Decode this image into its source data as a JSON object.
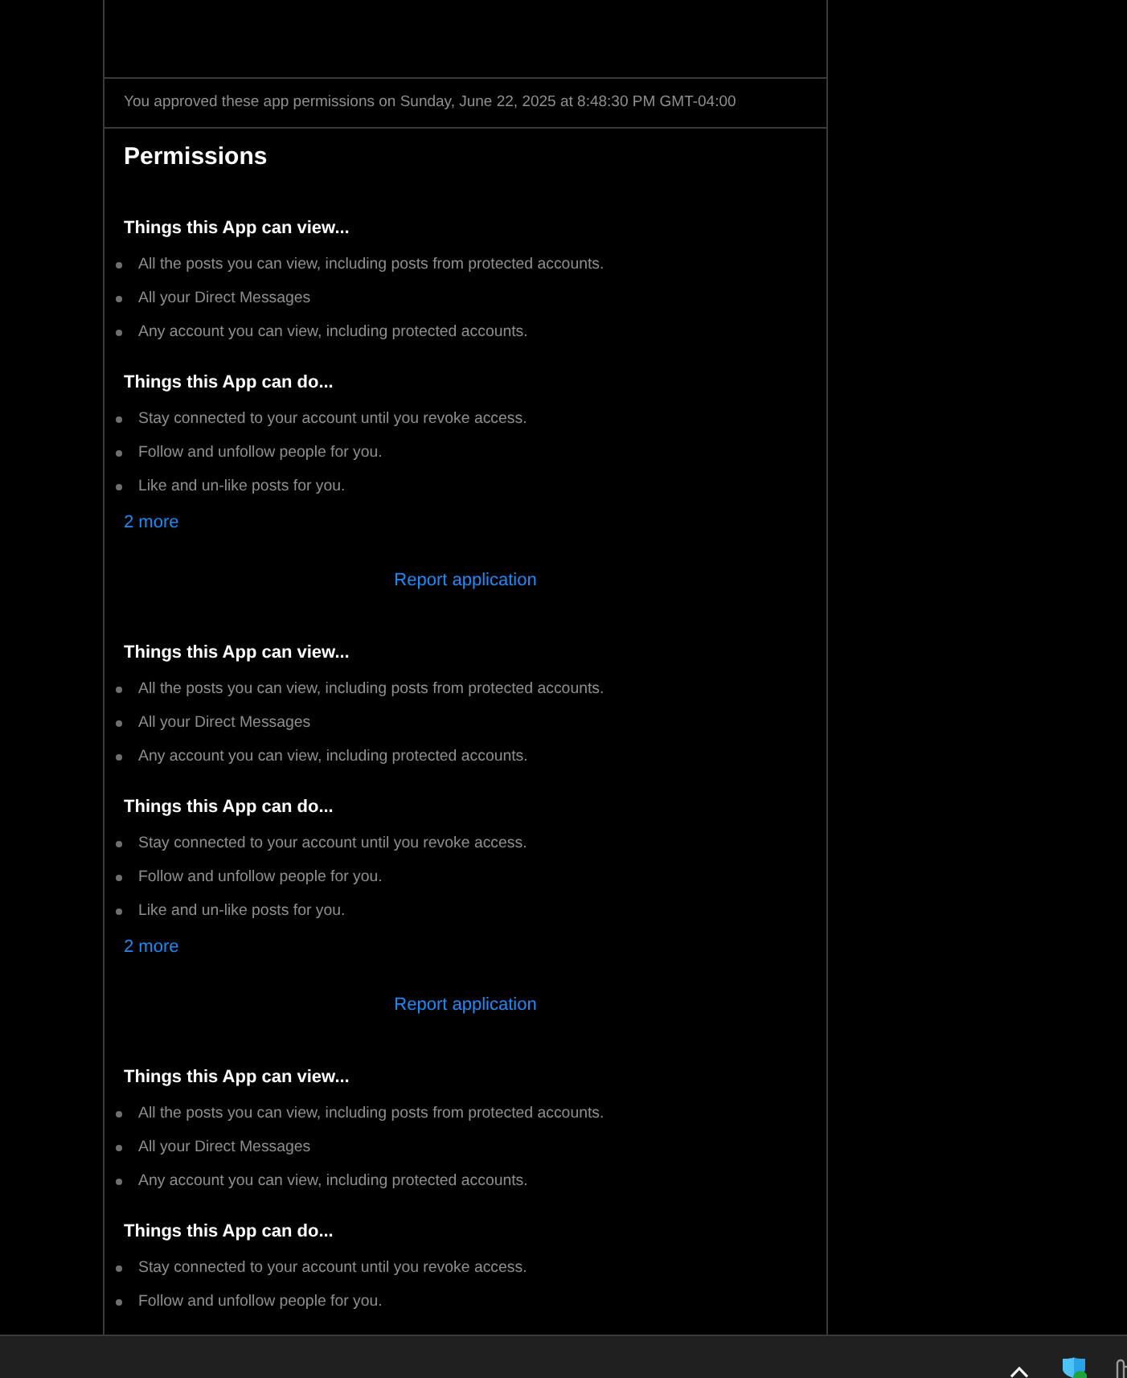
{
  "approval_note": "You approved these app permissions on Sunday, June 22, 2025 at 8:48:30 PM GMT-04:00",
  "permissions": {
    "title": "Permissions",
    "groups": [
      {
        "sections": [
          {
            "heading": "Things this App can view...",
            "items": [
              "All the posts you can view, including posts from protected accounts.",
              "All your Direct Messages",
              "Any account you can view, including protected accounts."
            ]
          },
          {
            "heading": "Things this App can do...",
            "items": [
              "Stay connected to your account until you revoke access.",
              "Follow and unfollow people for you.",
              "Like and un-like posts for you."
            ]
          }
        ],
        "more_link": "2 more",
        "report_link": "Report application"
      },
      {
        "sections": [
          {
            "heading": "Things this App can view...",
            "items": [
              "All the posts you can view, including posts from protected accounts.",
              "All your Direct Messages",
              "Any account you can view, including protected accounts."
            ]
          },
          {
            "heading": "Things this App can do...",
            "items": [
              "Stay connected to your account until you revoke access.",
              "Follow and unfollow people for you.",
              "Like and un-like posts for you."
            ]
          }
        ],
        "more_link": "2 more",
        "report_link": "Report application"
      },
      {
        "sections": [
          {
            "heading": "Things this App can view...",
            "items": [
              "All the posts you can view, including posts from protected accounts.",
              "All your Direct Messages",
              "Any account you can view, including protected accounts."
            ]
          },
          {
            "heading": "Things this App can do...",
            "items": [
              "Stay connected to your account until you revoke access.",
              "Follow and unfollow people for you."
            ]
          }
        ]
      }
    ]
  }
}
